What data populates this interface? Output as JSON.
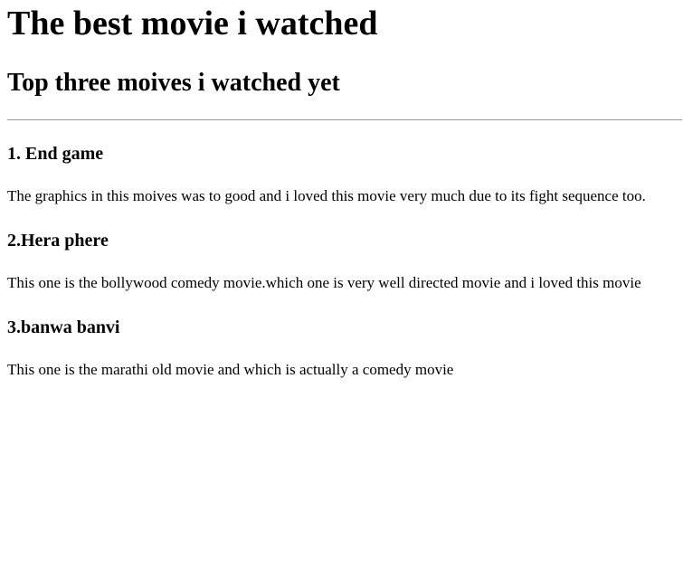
{
  "page": {
    "title": "The best movie i watched",
    "subtitle": "Top three moives i watched yet"
  },
  "movies": [
    {
      "heading": "1. End game",
      "text": "The graphics in this moives was to good and i loved this movie very much due to its fight sequence too."
    },
    {
      "heading": "2.Hera phere",
      "text": "This one is the bollywood comedy movie.which one is very well directed movie and i loved this movie"
    },
    {
      "heading": "3.banwa banvi",
      "text": "This one is the marathi old movie and which is actually a comedy movie"
    }
  ]
}
